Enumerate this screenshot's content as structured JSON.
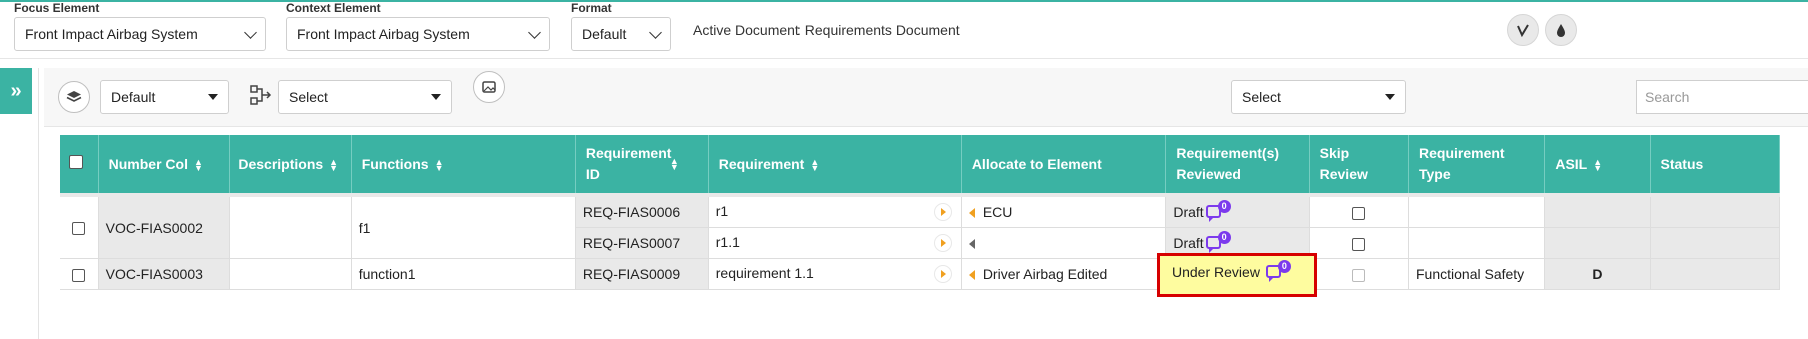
{
  "top": {
    "focus_element_label": "Focus Element",
    "focus_element_value": "Front Impact Airbag System",
    "context_element_label": "Context Element",
    "context_element_value": "Front Impact Airbag System",
    "format_label": "Format",
    "format_value": "Default",
    "active_document_label": "Active Document",
    "active_document_value": ": Requirements Document"
  },
  "toolbar": {
    "layer_select": "Default",
    "hierarchy_select": "Select",
    "right_select": "Select",
    "search_placeholder": "Search"
  },
  "table": {
    "headers": {
      "number_col": "Number Col",
      "descriptions": "Descriptions",
      "functions": "Functions",
      "requirement_id": "Requirement ID",
      "requirement": "Requirement",
      "allocate": "Allocate to Element",
      "reviewed": "Requirement(s) Reviewed",
      "skip_review": "Skip Review",
      "requirement_type": "Requirement Type",
      "asil": "ASIL",
      "status": "Status"
    },
    "rows": [
      {
        "number": "VOC-FIAS0002",
        "function": "f1",
        "sub": [
          {
            "req_id": "REQ-FIAS0006",
            "requirement": "r1",
            "allocate": "ECU",
            "reviewed": "Draft",
            "comments": "0"
          },
          {
            "req_id": "REQ-FIAS0007",
            "requirement": "r1.1",
            "allocate": "",
            "reviewed": "Draft",
            "comments": "0"
          }
        ]
      },
      {
        "number": "VOC-FIAS0003",
        "function": "function1",
        "req_id": "REQ-FIAS0009",
        "requirement": "requirement 1.1",
        "allocate": "Driver Airbag Edited",
        "reviewed": "Under Review",
        "comments": "0",
        "requirement_type": "Functional Safety",
        "asil": "D"
      }
    ]
  },
  "colors": {
    "accent": "#3bb3a3",
    "highlight_border": "#d60000",
    "highlight_fill": "#fefc9f",
    "comment_badge": "#7c3aed"
  }
}
